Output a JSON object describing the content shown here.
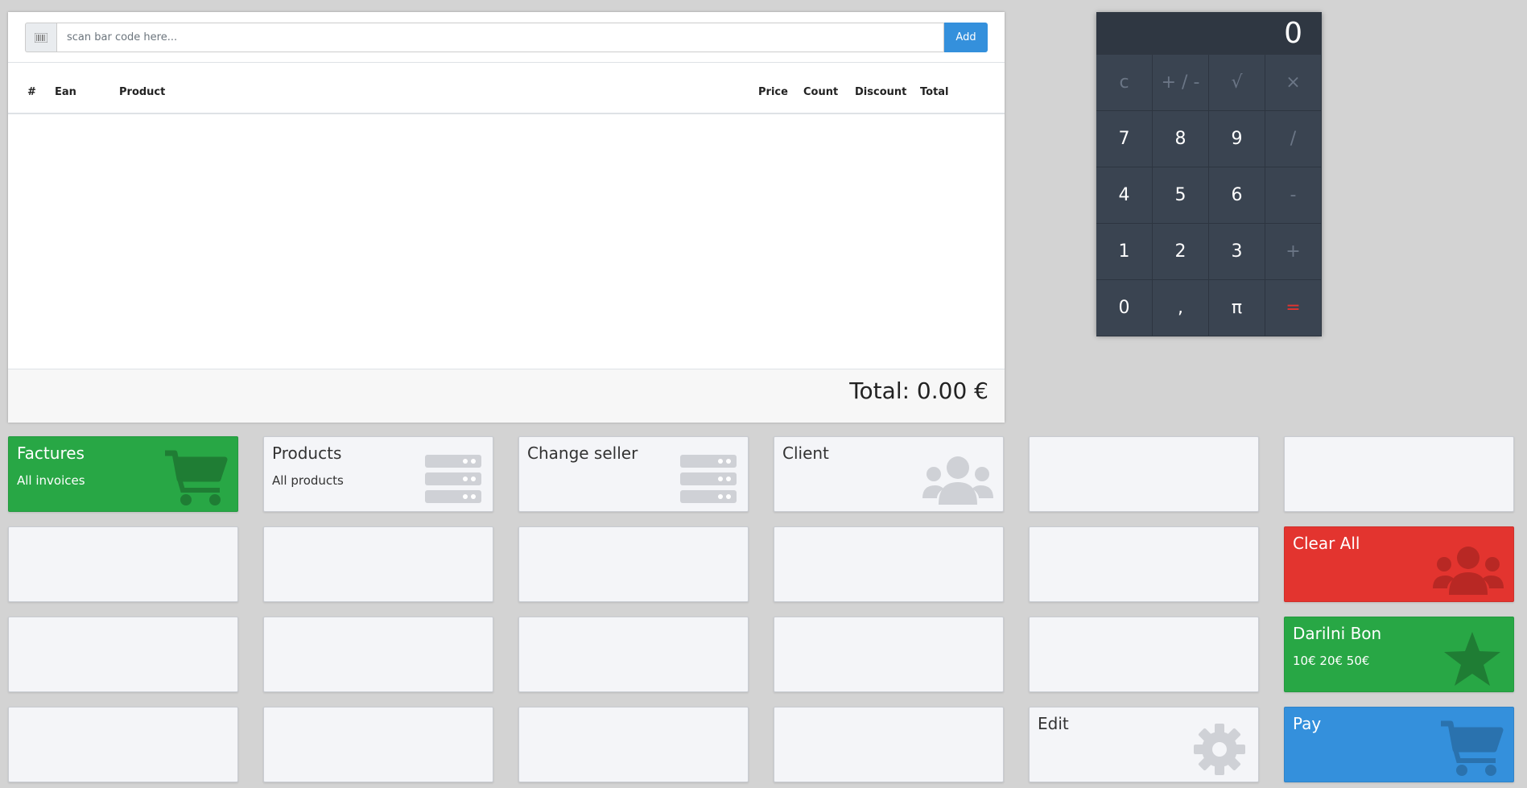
{
  "scan": {
    "placeholder": "scan bar code here...",
    "add_label": "Add",
    "icon": "barcode-icon"
  },
  "order_table": {
    "columns": {
      "index": "#",
      "ean": "Ean",
      "product": "Product",
      "price": "Price",
      "count": "Count",
      "discount": "Discount",
      "total": "Total"
    },
    "rows": []
  },
  "footer": {
    "total_label": "Total: 0.00 €"
  },
  "calculator": {
    "display": "0",
    "keys": [
      "c",
      "+ / -",
      "√",
      "×",
      "7",
      "8",
      "9",
      "/",
      "4",
      "5",
      "6",
      "-",
      "1",
      "2",
      "3",
      "+",
      "0",
      ",",
      "π",
      "="
    ]
  },
  "tiles": {
    "factures": {
      "title": "Factures",
      "subtitle": "All invoices",
      "icon": "cart-icon",
      "color": "#28a745"
    },
    "products": {
      "title": "Products",
      "subtitle": "All products",
      "icon": "server-icon"
    },
    "change_seller": {
      "title": "Change seller",
      "icon": "server-icon"
    },
    "client": {
      "title": "Client",
      "icon": "users-icon"
    },
    "clear_all": {
      "title": "Clear All",
      "icon": "users-icon",
      "color": "#e3342f"
    },
    "darilni_bon": {
      "title": "Darilni Bon",
      "subtitle": "10€ 20€ 50€",
      "icon": "star-icon",
      "color": "#28a745"
    },
    "edit": {
      "title": "Edit",
      "icon": "gear-icon"
    },
    "pay": {
      "title": "Pay",
      "icon": "cart-icon",
      "color": "#3490dc"
    }
  },
  "colors": {
    "background": "#d3d3d3",
    "accent_blue": "#3490dc",
    "calculator": "#3a4451"
  }
}
